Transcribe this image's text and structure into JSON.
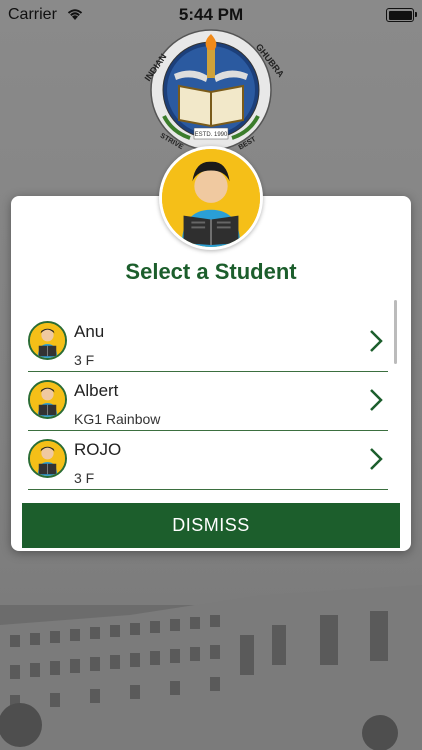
{
  "status_bar": {
    "carrier": "Carrier",
    "time": "5:44 PM"
  },
  "logo": {
    "top_text": "INDIAN",
    "top_text_right": "GHUBRA",
    "motto": "STRIVE",
    "motto_right": "BEST",
    "established": "ESTD. 1990"
  },
  "modal": {
    "title": "Select a Student",
    "dismiss_label": "DISMISS",
    "students": [
      {
        "name": "Anu",
        "class": "3 F"
      },
      {
        "name": "Albert",
        "class": "KG1 Rainbow"
      },
      {
        "name": "ROJO",
        "class": "3 F"
      }
    ]
  },
  "colors": {
    "accent_green": "#1c5e2c",
    "avatar_yellow": "#f5bf18"
  },
  "icons": [
    "wifi-icon",
    "battery-icon",
    "student-avatar-icon",
    "chevron-right-icon"
  ]
}
